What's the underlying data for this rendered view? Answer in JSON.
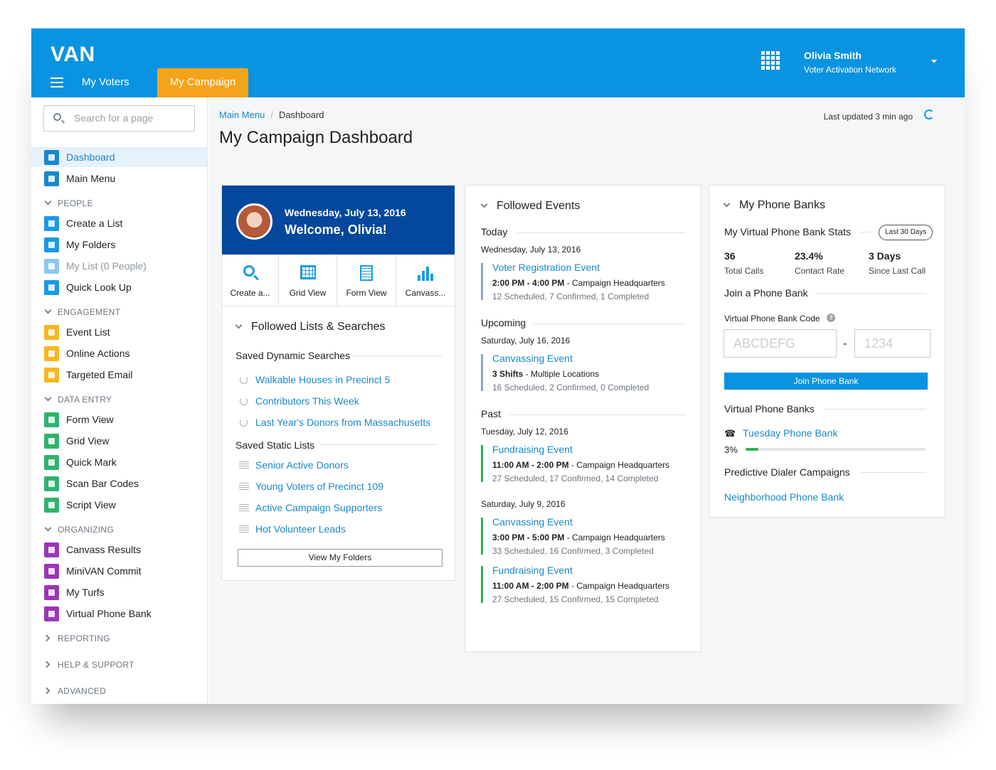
{
  "header": {
    "logo": "VAN",
    "tabs": [
      {
        "label": "My Voters",
        "active": false
      },
      {
        "label": "My Campaign",
        "active": true
      }
    ],
    "user_name": "Olivia Smith",
    "user_org": "Voter Activation Network",
    "accent_color": "#0a93e0",
    "active_tab_color": "#f5a31a"
  },
  "sidebar": {
    "search_placeholder": "Search for a page",
    "top_items": [
      {
        "label": "Dashboard",
        "icon": "dashboard-icon",
        "color": "#1a88c9",
        "active": true
      },
      {
        "label": "Main Menu",
        "icon": "home-icon",
        "color": "#1a88c9"
      }
    ],
    "sections": [
      {
        "title": "PEOPLE",
        "expanded": true,
        "items": [
          {
            "label": "Create a List",
            "icon": "search-icon",
            "color": "#1a9ae6"
          },
          {
            "label": "My Folders",
            "icon": "folder-icon",
            "color": "#1a9ae6"
          },
          {
            "label": "My List (0 People)",
            "icon": "list-icon",
            "color": "#8cc8ef",
            "disabled": true
          },
          {
            "label": "Quick Look Up",
            "icon": "id-card-icon",
            "color": "#1a9ae6"
          }
        ]
      },
      {
        "title": "ENGAGEMENT",
        "expanded": true,
        "items": [
          {
            "label": "Event List",
            "icon": "clipboard-icon",
            "color": "#f5b71f"
          },
          {
            "label": "Online Actions",
            "icon": "form-icon",
            "color": "#f5b71f"
          },
          {
            "label": "Targeted Email",
            "icon": "email-icon",
            "color": "#f5b71f"
          }
        ]
      },
      {
        "title": "DATA ENTRY",
        "expanded": true,
        "items": [
          {
            "label": "Form View",
            "icon": "form-icon",
            "color": "#2fb36e"
          },
          {
            "label": "Grid View",
            "icon": "grid-icon",
            "color": "#2fb36e"
          },
          {
            "label": "Quick Mark",
            "icon": "book-icon",
            "color": "#2fb36e"
          },
          {
            "label": "Scan Bar Codes",
            "icon": "barcode-icon",
            "color": "#2fb36e"
          },
          {
            "label": "Script View",
            "icon": "script-icon",
            "color": "#2fb36e"
          }
        ]
      },
      {
        "title": "ORGANIZING",
        "expanded": true,
        "items": [
          {
            "label": "Canvass Results",
            "icon": "bar-chart-icon",
            "color": "#9b36b7"
          },
          {
            "label": "MiniVAN Commit",
            "icon": "phone-icon",
            "color": "#9b36b7"
          },
          {
            "label": "My Turfs",
            "icon": "globe-icon",
            "color": "#9b36b7"
          },
          {
            "label": "Virtual Phone Bank",
            "icon": "telephone-icon",
            "color": "#9b36b7"
          }
        ]
      },
      {
        "title": "REPORTING",
        "expanded": false,
        "items": []
      },
      {
        "title": "HELP & SUPPORT",
        "expanded": false,
        "items": []
      },
      {
        "title": "ADVANCED",
        "expanded": false,
        "items": []
      }
    ]
  },
  "main": {
    "breadcrumb": {
      "root": "Main Menu",
      "separator": "/",
      "current": "Dashboard"
    },
    "last_updated": "Last updated 3 min ago",
    "title": "My Campaign Dashboard"
  },
  "welcome": {
    "date": "Wednesday, July 13, 2016",
    "greeting": "Welcome, Olivia!",
    "quick_actions": [
      {
        "label": "Create a...",
        "icon": "search-icon"
      },
      {
        "label": "Grid View",
        "icon": "grid-icon"
      },
      {
        "label": "Form View",
        "icon": "form-icon"
      },
      {
        "label": "Canvass...",
        "icon": "bar-chart-icon"
      }
    ]
  },
  "followed_lists": {
    "title": "Followed Lists & Searches",
    "dynamic_title": "Saved Dynamic Searches",
    "dynamic": [
      "Walkable Houses in Precinct 5",
      "Contributors This Week",
      "Last Year's Donors from Massachusetts"
    ],
    "static_title": "Saved Static Lists",
    "static": [
      "Senior Active Donors",
      "Young Voters of Precinct 109",
      "Active Campaign Supporters",
      "Hot Volunteer Leads"
    ],
    "button": "View My Folders"
  },
  "followed_events": {
    "title": "Followed Events",
    "sections": [
      {
        "label": "Today",
        "days": [
          {
            "date": "Wednesday, July 13, 2016",
            "events": [
              {
                "title": "Voter Registration Event",
                "time": "2:00 PM - 4:00 PM",
                "location": " - Campaign Headquarters",
                "stats": "12 Scheduled, 7 Confirmed, 1 Completed",
                "bar_color": "#8fa9c4"
              }
            ]
          }
        ]
      },
      {
        "label": "Upcoming",
        "days": [
          {
            "date": "Saturday, July 16, 2016",
            "events": [
              {
                "title": "Canvassing Event",
                "time": "3 Shifts",
                "location": " - Multiple Locations",
                "stats": "16 Scheduled, 2 Confirmed, 0 Completed",
                "bar_color": "#8fa9c4"
              }
            ]
          }
        ]
      },
      {
        "label": "Past",
        "days": [
          {
            "date": "Tuesday, July 12, 2016",
            "events": [
              {
                "title": "Fundraising Event",
                "time": "11:00 AM - 2:00 PM",
                "location": " - Campaign Headquarters",
                "stats": "27 Scheduled, 17 Confirmed, 14 Completed",
                "bar_color": "#2fb350"
              }
            ]
          },
          {
            "date": "Saturday, July 9, 2016",
            "events": [
              {
                "title": "Canvassing Event",
                "time": "3:00 PM - 5:00 PM",
                "location": " - Campaign Headquarters",
                "stats": "33 Scheduled, 16 Confirmed, 3 Completed",
                "bar_color": "#2fb350"
              },
              {
                "title": "Fundraising Event",
                "time": "11:00 AM - 2:00 PM",
                "location": " - Campaign Headquarters",
                "stats": "27 Scheduled, 15 Confirmed, 15 Completed",
                "bar_color": "#2fb350"
              }
            ]
          }
        ]
      }
    ]
  },
  "phone_banks": {
    "title": "My Phone Banks",
    "stats_title": "My Virtual Phone Bank Stats",
    "period": "Last 30 Days",
    "stats": [
      {
        "value": "36",
        "label": "Total Calls"
      },
      {
        "value": "23.4%",
        "label": "Contact Rate"
      },
      {
        "value": "3 Days",
        "label": "Since Last Call"
      }
    ],
    "join_title": "Join a Phone Bank",
    "code_label": "Virtual Phone Bank Code",
    "code_placeholder_1": "ABCDEFG",
    "code_separator": "-",
    "code_placeholder_2": "1234",
    "join_button": "Join Phone Bank",
    "vpb_title": "Virtual Phone Banks",
    "vpb_item": "Tuesday Phone Bank",
    "vpb_progress_label": "3%",
    "vpb_progress": 0.03,
    "dialer_title": "Predictive Dialer Campaigns",
    "dialer_item": "Neighborhood Phone Bank"
  }
}
